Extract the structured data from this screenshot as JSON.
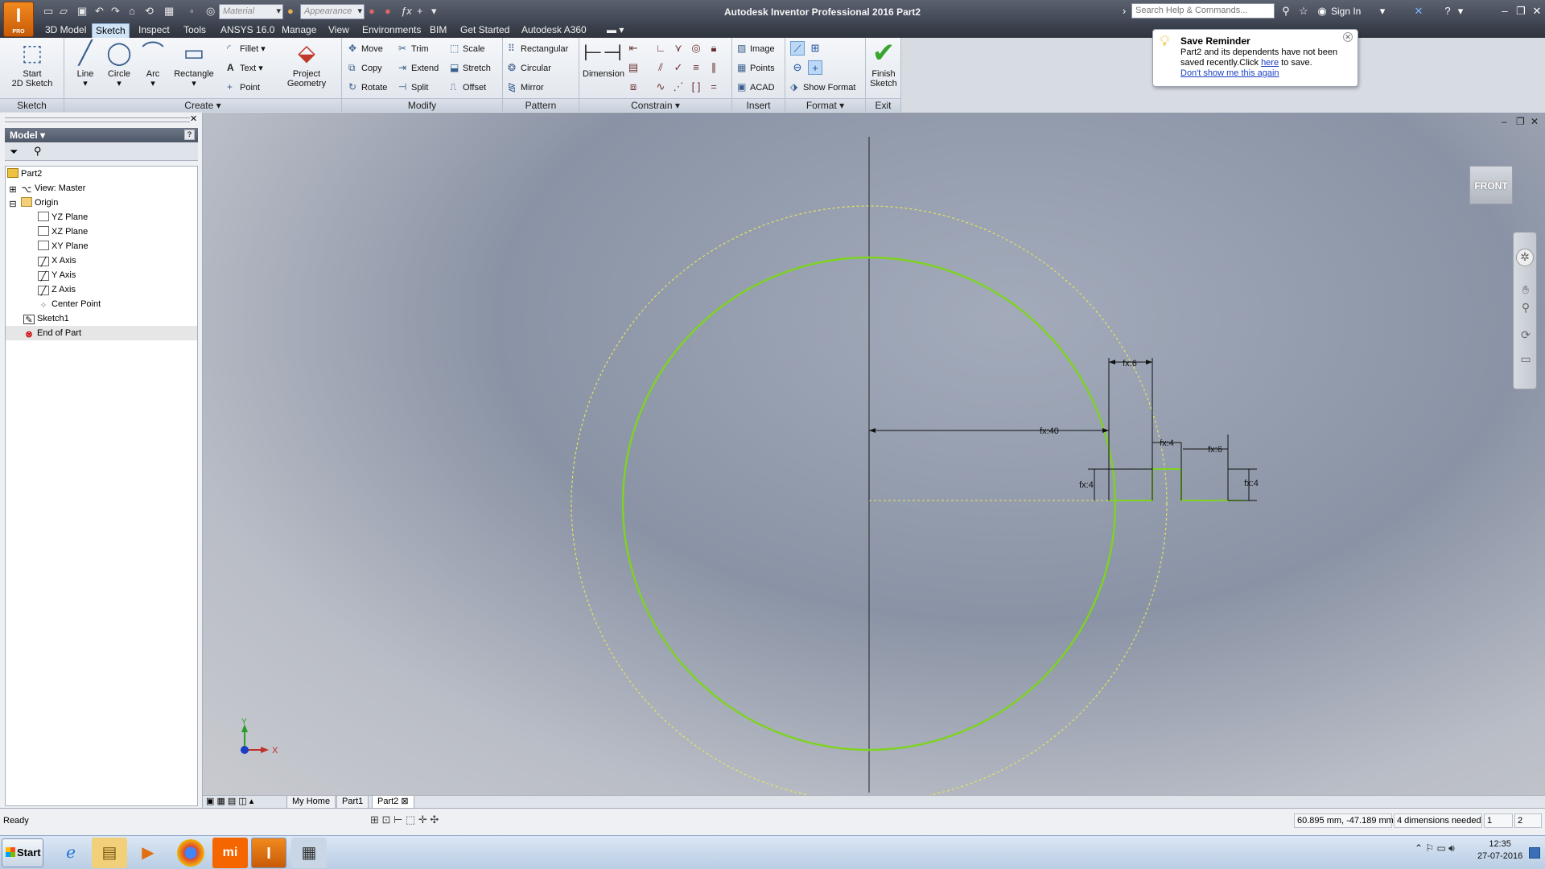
{
  "app": {
    "title": "Autodesk Inventor Professional 2016  Part2",
    "logo_letter": "I",
    "logo_sub": "PRO"
  },
  "quick_access": {
    "material_placeholder": "Material",
    "appearance_placeholder": "Appearance",
    "help_search_placeholder": "Search Help & Commands...",
    "sign_in": "Sign In"
  },
  "ribbon_tabs": [
    "3D Model",
    "Sketch",
    "Inspect",
    "Tools",
    "ANSYS 16.0",
    "Manage",
    "View",
    "Environments",
    "BIM",
    "Get Started",
    "Autodesk A360"
  ],
  "ribbon": {
    "sketch_panel": {
      "label": "Sketch",
      "start_2d_sketch": "Start\n2D Sketch"
    },
    "create_panel": {
      "label": "Create",
      "line": "Line",
      "circle": "Circle",
      "arc": "Arc",
      "rectangle": "Rectangle",
      "fillet": "Fillet",
      "text": "Text",
      "point": "Point",
      "project_geometry": "Project\nGeometry"
    },
    "modify_panel": {
      "label": "Modify",
      "move": "Move",
      "copy": "Copy",
      "rotate": "Rotate",
      "trim": "Trim",
      "extend": "Extend",
      "split": "Split",
      "scale": "Scale",
      "stretch": "Stretch",
      "offset": "Offset"
    },
    "pattern_panel": {
      "label": "Pattern",
      "rectangular": "Rectangular",
      "circular": "Circular",
      "mirror": "Mirror"
    },
    "constrain_panel": {
      "label": "Constrain",
      "dimension": "Dimension"
    },
    "insert_panel": {
      "label": "Insert",
      "image": "Image",
      "points": "Points",
      "acad": "ACAD"
    },
    "format_panel": {
      "label": "Format",
      "show_format": "Show Format"
    },
    "exit_panel": {
      "label": "Exit",
      "finish_sketch": "Finish\nSketch"
    }
  },
  "save_reminder": {
    "title": "Save Reminder",
    "message_1": "Part2 and its dependents have not been saved recently.Click ",
    "link_here": "here",
    "message_2": " to save.",
    "dont_show": "Don't show me this again"
  },
  "browser": {
    "title": "Model",
    "help": "?",
    "tree": [
      {
        "label": "Part2",
        "icon": "part-icon"
      },
      {
        "label": "View: Master",
        "icon": "view-icon"
      },
      {
        "label": "Origin",
        "icon": "folder-icon"
      },
      {
        "label": "YZ Plane",
        "icon": "plane-icon"
      },
      {
        "label": "XZ Plane",
        "icon": "plane-icon"
      },
      {
        "label": "XY Plane",
        "icon": "plane-icon"
      },
      {
        "label": "X Axis",
        "icon": "axis-icon"
      },
      {
        "label": "Y Axis",
        "icon": "axis-icon"
      },
      {
        "label": "Z Axis",
        "icon": "axis-icon"
      },
      {
        "label": "Center Point",
        "icon": "point-icon"
      },
      {
        "label": "Sketch1",
        "icon": "sketch-icon"
      },
      {
        "label": "End of Part",
        "icon": "end-of-part-icon"
      }
    ]
  },
  "viewport": {
    "view_cube_label": "FRONT",
    "triad_x": "X",
    "triad_y": "Y",
    "dimensions": {
      "d_top": "fx:6",
      "d_main": "fx:40",
      "d_mid": "fx:4",
      "d_right": "fx:6",
      "d_left_vert": "fx:4",
      "d_right_vert": "fx:4"
    },
    "colors": {
      "sketch_green": "#7ed321",
      "dim_line": "#111111",
      "dashed_circle": "#e6e65a"
    }
  },
  "doc_tabs": [
    "My Home",
    "Part1",
    "Part2"
  ],
  "status": {
    "text": "Ready",
    "coords": "60.895 mm, -47.189 mm",
    "dims_needed": "4 dimensions needed",
    "field_1": "1",
    "field_2": "2"
  },
  "taskbar": {
    "start": "Start",
    "time": "12:35",
    "date": "27-07-2016",
    "apps": [
      "ie-icon",
      "explorer-icon",
      "media-player-icon",
      "chrome-icon",
      "mi-icon",
      "inventor-icon",
      "calculator-icon"
    ]
  }
}
